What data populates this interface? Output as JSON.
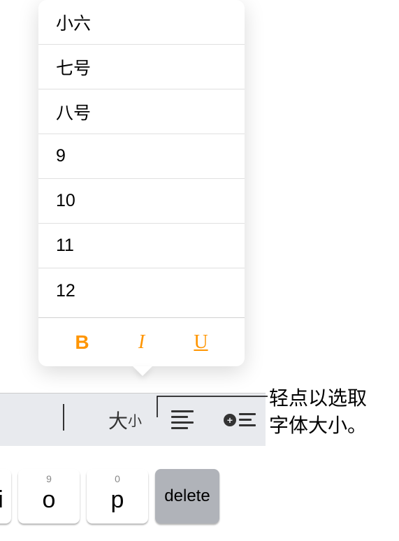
{
  "popover": {
    "sizes": [
      "小六",
      "七号",
      "八号",
      "9",
      "10",
      "11",
      "12"
    ],
    "format": {
      "bold": "B",
      "italic": "I",
      "underline": "U"
    }
  },
  "toolbar": {
    "size_label_large": "大",
    "size_label_small": "小"
  },
  "keyboard": {
    "keys": [
      {
        "sub": "",
        "main": "i"
      },
      {
        "sub": "9",
        "main": "o"
      },
      {
        "sub": "0",
        "main": "p"
      }
    ],
    "delete": "delete"
  },
  "callout": {
    "line1": "轻点以选取",
    "line2": "字体大小。"
  }
}
